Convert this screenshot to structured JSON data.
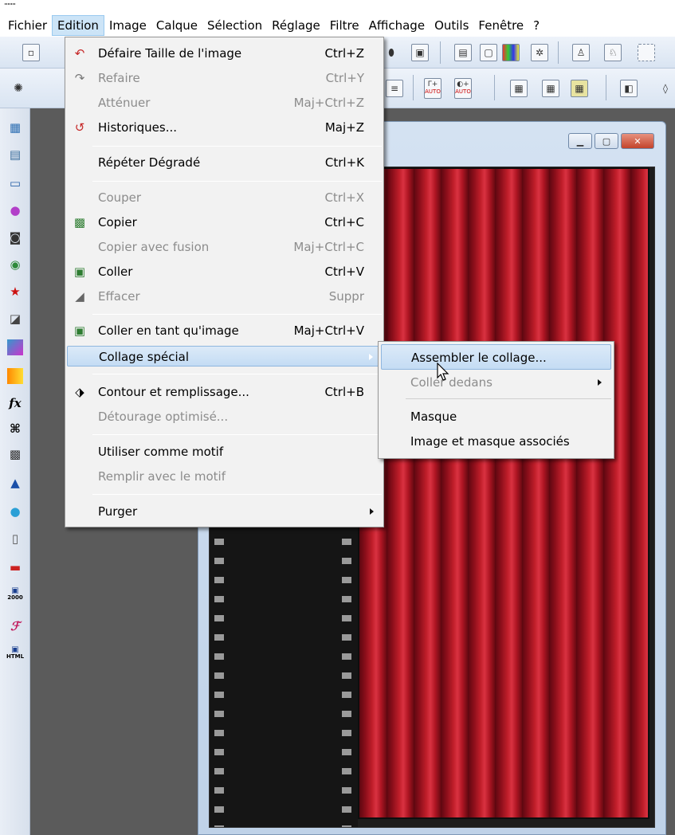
{
  "menubar": {
    "items": [
      "Fichier",
      "Edition",
      "Image",
      "Calque",
      "Sélection",
      "Réglage",
      "Filtre",
      "Affichage",
      "Outils",
      "Fenêtre",
      "?"
    ],
    "active_index": 1
  },
  "edition_menu": {
    "items": [
      {
        "label": "Défaire Taille de l'image",
        "shortcut": "Ctrl+Z",
        "enabled": true,
        "icon": "undo-icon"
      },
      {
        "label": "Refaire",
        "shortcut": "Ctrl+Y",
        "enabled": false,
        "icon": "redo-icon"
      },
      {
        "label": "Atténuer",
        "shortcut": "Maj+Ctrl+Z",
        "enabled": false
      },
      {
        "label": "Historiques...",
        "shortcut": "Maj+Z",
        "enabled": true,
        "icon": "history-icon"
      },
      {
        "label": "Répéter Dégradé",
        "shortcut": "Ctrl+K",
        "enabled": true
      },
      {
        "label": "Couper",
        "shortcut": "Ctrl+X",
        "enabled": false
      },
      {
        "label": "Copier",
        "shortcut": "Ctrl+C",
        "enabled": true,
        "icon": "copy-icon"
      },
      {
        "label": "Copier avec fusion",
        "shortcut": "Maj+Ctrl+C",
        "enabled": false
      },
      {
        "label": "Coller",
        "shortcut": "Ctrl+V",
        "enabled": true,
        "icon": "paste-icon"
      },
      {
        "label": "Effacer",
        "shortcut": "Suppr",
        "enabled": false,
        "icon": "eraser-icon"
      },
      {
        "label": "Coller en tant qu'image",
        "shortcut": "Maj+Ctrl+V",
        "enabled": true,
        "icon": "paste-as-image-icon"
      },
      {
        "label": "Collage spécial",
        "shortcut": "",
        "enabled": true,
        "submenu": true,
        "highlighted": true
      },
      {
        "label": "Contour et remplissage...",
        "shortcut": "Ctrl+B",
        "enabled": true,
        "icon": "fill-bucket-icon"
      },
      {
        "label": "Détourage optimisé...",
        "shortcut": "",
        "enabled": false
      },
      {
        "label": "Utiliser comme motif",
        "shortcut": "",
        "enabled": true
      },
      {
        "label": "Remplir avec le motif",
        "shortcut": "",
        "enabled": false
      },
      {
        "label": "Purger",
        "shortcut": "",
        "enabled": true,
        "submenu": true
      }
    ]
  },
  "collage_submenu": {
    "items": [
      {
        "label": "Assembler le collage...",
        "enabled": true,
        "highlighted": true
      },
      {
        "label": "Coller dedans",
        "enabled": false,
        "submenu": true
      },
      {
        "label": "Masque",
        "enabled": true
      },
      {
        "label": "Image et masque associés",
        "enabled": true
      }
    ]
  },
  "toolbar_auto_labels": {
    "levels_auto": "AUTO",
    "contrast_auto": "AUTO"
  },
  "left_tools": {
    "fx_label": "fx",
    "save_2000_label": "2000",
    "save_html_label": "HTML"
  },
  "colors": {
    "menu_bg": "#f2f2f2",
    "highlight": "#c4dcf4",
    "disabled_text": "#8c8c8c",
    "curtain_red": "#c01e2a",
    "workspace": "#5b5b5b"
  }
}
